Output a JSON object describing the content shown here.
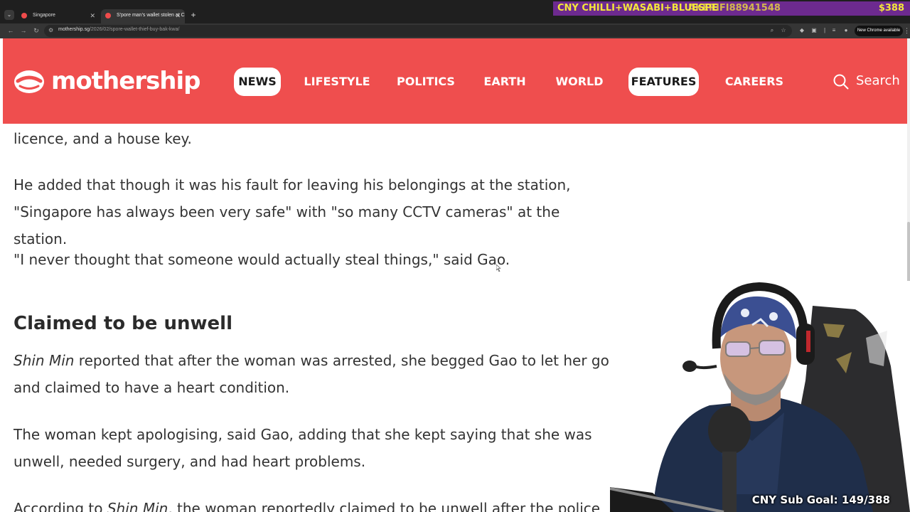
{
  "browser": {
    "tabs": [
      {
        "title": "Singapore"
      },
      {
        "title": "S'pore man's wallet stolen at C"
      }
    ],
    "url_host": "mothership.sg",
    "url_path": "/2026/02/spore-wallet-thief-buy-bak-kwa/",
    "update_label": "New Chrome available"
  },
  "stream_overlay": {
    "ticker": "CNY CHILLI+WASABI+BLUESPE",
    "ticker_ghost": "AKERIFI88941548",
    "amount": "$388",
    "sub_goal": "CNY Sub Goal: 149/388"
  },
  "site": {
    "logo": "mothership",
    "nav": [
      {
        "label": "NEWS",
        "active": true
      },
      {
        "label": "LIFESTYLE",
        "active": false
      },
      {
        "label": "POLITICS",
        "active": false
      },
      {
        "label": "EARTH",
        "active": false
      },
      {
        "label": "WORLD",
        "active": false
      },
      {
        "label": "FEATURES",
        "active": true
      },
      {
        "label": "CAREERS",
        "active": false
      }
    ],
    "search_label": "Search"
  },
  "article": {
    "p1": "licence, and a house key.",
    "p2_line1": "He added that though it was his fault for leaving his belongings at the station,",
    "p2_line2": "\"Singapore has always been very safe\" with \"so many CCTV cameras\" at the station.",
    "p3": "\"I never thought that someone would actually steal things,\" said Gao.",
    "heading": "Claimed to be unwell",
    "p4_source": "Shin Min",
    "p4_line1_rest": " reported that after the woman was arrested, she begged Gao to let her go",
    "p4_line2": "and claimed to have a heart condition.",
    "p5_line1": "The woman kept apologising, said Gao, adding that she kept saying that she was",
    "p5_line2": "unwell, needed surgery, and had heart problems.",
    "p6_start": "According to",
    "p6_source": "Shin Min",
    "p6_rest": ", the woman reportedly claimed to be unwell after the police"
  }
}
